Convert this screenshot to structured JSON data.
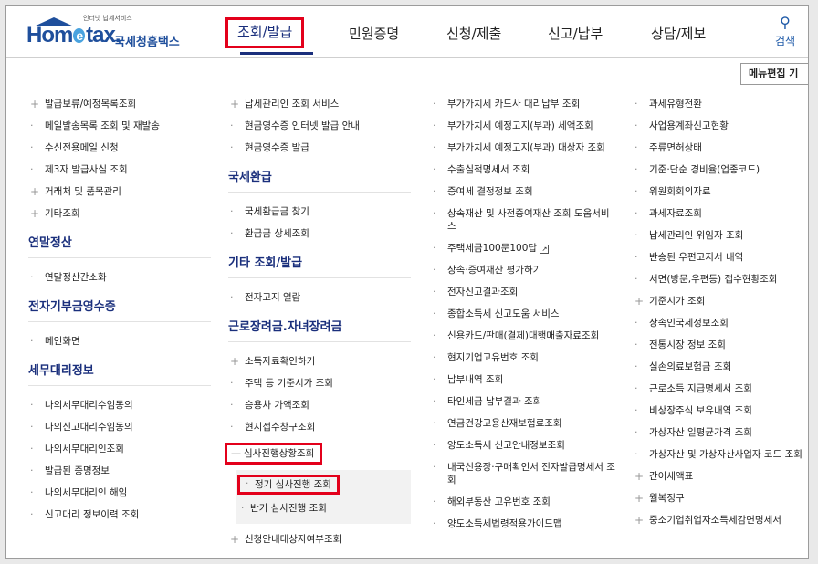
{
  "header": {
    "logo_tagline": "인터넷 납세서비스",
    "logo_home": "Hom",
    "logo_e": "e",
    "logo_tax": "tax.",
    "logo_sub": "국세청홈택스",
    "nav": [
      "조회/발급",
      "민원증명",
      "신청/제출",
      "신고/납부",
      "상담/제보"
    ],
    "search_label": "검색",
    "menu_edit_label": "메뉴편집 기"
  },
  "col1": {
    "items": [
      {
        "label": "발급보류/예정목록조회",
        "type": "plus"
      },
      {
        "label": "메일발송목록 조회 및 재발송",
        "type": "dot"
      },
      {
        "label": "수신전용메일 신청",
        "type": "dot"
      },
      {
        "label": "제3자 발급사실 조회",
        "type": "dot"
      },
      {
        "label": "거래처 및 품목관리",
        "type": "plus"
      },
      {
        "label": "기타조회",
        "type": "plus"
      }
    ],
    "section2": {
      "title": "연말정산",
      "items": [
        "연말정산간소화"
      ]
    },
    "section3": {
      "title": "전자기부금영수증",
      "items": [
        "메인화면"
      ]
    },
    "section4": {
      "title": "세무대리정보",
      "items": [
        "나의세무대리수임동의",
        "나의신고대리수임동의",
        "나의세무대리인조회",
        "발급된 증명정보",
        "나의세무대리인 해임",
        "신고대리 정보이력 조회"
      ]
    }
  },
  "col2": {
    "items": [
      {
        "label": "납세관리인 조회 서비스",
        "type": "plus"
      },
      {
        "label": "현금영수증 인터넷 발급 안내",
        "type": "dot"
      },
      {
        "label": "현금영수증 발급",
        "type": "dot"
      }
    ],
    "section2": {
      "title": "국세환급",
      "items": [
        "국세환급금 찾기",
        "환급금 상세조회"
      ]
    },
    "section3": {
      "title": "기타 조회/발급",
      "items": [
        "전자고지 열람"
      ]
    },
    "section4": {
      "title": "근로장려금.자녀장려금",
      "items": [
        {
          "label": "소득자료확인하기",
          "type": "plus"
        },
        {
          "label": "주택 등 기준시가 조회",
          "type": "dot"
        },
        {
          "label": "승용차 가액조회",
          "type": "dot"
        },
        {
          "label": "현지접수창구조회",
          "type": "dot"
        }
      ],
      "expanded": {
        "label": "심사진행상황조회",
        "mark": "—"
      },
      "subitems": [
        "정기 심사진행 조회",
        "반기 심사진행 조회"
      ],
      "last": "신청안내대상자여부조회"
    }
  },
  "col3": {
    "items": [
      "부가가치세 카드사 대리납부 조회",
      "부가가치세 예정고지(부과) 세액조회",
      "부가가치세 예정고지(부과) 대상자 조회",
      "수출실적명세서 조회",
      "증여세 결정정보 조회",
      "상속재산 및 사전증여재산 조회 도움서비스",
      "주택세금100문100답",
      "상속·증여재산 평가하기",
      "전자신고결과조회",
      "종합소득세 신고도움 서비스",
      "신용카드/판매(결제)대행매출자료조회",
      "현지기업고유번호 조회",
      "납부내역 조회",
      "타인세금 납부결과 조회",
      "연금건강고용산재보험료조회",
      "양도소득세 신고안내정보조회",
      "내국신용장·구매확인서 전자발급명세서 조회",
      "해외부동산 고유번호 조회",
      "양도소득세법령적용가이드맵"
    ]
  },
  "col4": {
    "items": [
      {
        "label": "과세유형전환",
        "type": "dot"
      },
      {
        "label": "사업용계좌신고현황",
        "type": "dot"
      },
      {
        "label": "주류면허상태",
        "type": "dot"
      },
      {
        "label": "기준·단순 경비율(업종코드)",
        "type": "dot"
      },
      {
        "label": "위원회회의자료",
        "type": "dot"
      },
      {
        "label": "과세자료조회",
        "type": "dot"
      },
      {
        "label": "납세관리인 위임자 조회",
        "type": "dot"
      },
      {
        "label": "반송된 우편고지서 내역",
        "type": "dot"
      },
      {
        "label": "서면(방문,우편등) 접수현황조회",
        "type": "dot"
      },
      {
        "label": "기준시가 조회",
        "type": "plus"
      },
      {
        "label": "상속인국세정보조회",
        "type": "dot"
      },
      {
        "label": "전통시장 정보 조회",
        "type": "dot"
      },
      {
        "label": "실손의료보험금 조회",
        "type": "dot"
      },
      {
        "label": "근로소득 지급명세서 조회",
        "type": "dot"
      },
      {
        "label": "비상장주식 보유내역 조회",
        "type": "dot"
      },
      {
        "label": "가상자산 일평균가격 조회",
        "type": "dot"
      },
      {
        "label": "가상자산 및 가상자산사업자 코드 조회",
        "type": "dot"
      },
      {
        "label": "간이세액표",
        "type": "plus"
      },
      {
        "label": "월복정구",
        "type": "plus"
      },
      {
        "label": "중소기업취업자소득세감면명세서",
        "type": "plus"
      }
    ]
  },
  "colors": {
    "accent": "#1a2f7c",
    "highlight": "#e3001b",
    "brand": "#1f4f9c"
  },
  "icons": {
    "plus": "plus-icon",
    "dot": "bullet-icon",
    "search": "search-icon",
    "external": "external-link-icon"
  }
}
